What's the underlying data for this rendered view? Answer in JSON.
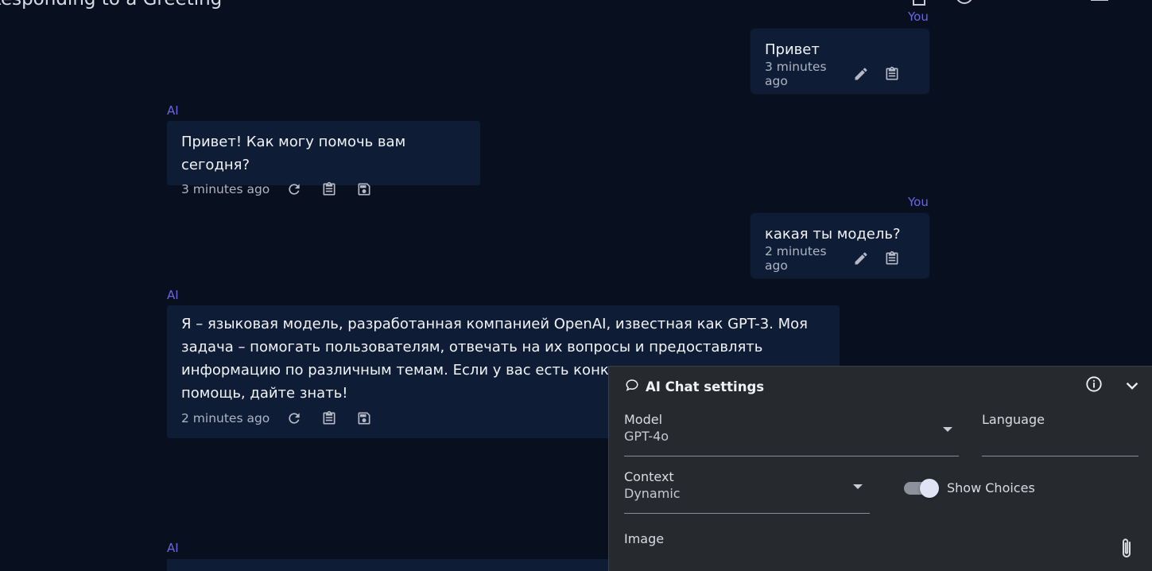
{
  "header": {
    "title": "Responding to a Greeting",
    "icons": [
      "clipboard-icon",
      "history-icon",
      "plus-icon",
      "list-icon",
      "grid-icon",
      "more-icon"
    ]
  },
  "messages": [
    {
      "sender": "You",
      "role": "user",
      "text": "Привет",
      "time": "3 minutes ago",
      "actions": [
        "edit-icon",
        "copy-icon"
      ]
    },
    {
      "sender": "AI",
      "role": "ai",
      "text": "Привет! Как могу помочь вам сегодня?",
      "time": "3 minutes ago",
      "actions": [
        "regenerate-icon",
        "copy-icon",
        "save-icon"
      ]
    },
    {
      "sender": "You",
      "role": "user",
      "text": "какая ты модель?",
      "time": "2 minutes ago",
      "actions": [
        "edit-icon",
        "copy-icon"
      ]
    },
    {
      "sender": "AI",
      "role": "ai",
      "text": "Я – языковая модель, разработанная компанией OpenAI, известная как GPT-3. Моя задача – помогать пользователям, отвечать на их вопросы и предоставлять информацию по различным темам. Если у вас есть конкр",
      "text_tail": "помощь, дайте знать!",
      "time": "2 minutes ago",
      "actions": [
        "regenerate-icon",
        "copy-icon",
        "save-icon"
      ]
    },
    {
      "sender": "AI",
      "role": "ai"
    }
  ],
  "settings": {
    "title": "AI Chat settings",
    "model": {
      "label": "Model",
      "value": "GPT-4o"
    },
    "language": {
      "label": "Language",
      "value": ""
    },
    "context": {
      "label": "Context",
      "value": "Dynamic"
    },
    "show_choices": {
      "label": "Show Choices",
      "enabled": true
    },
    "image": {
      "label": "Image"
    }
  },
  "colors": {
    "background": "#080f1e",
    "bubble": "#0f1c36",
    "sender_label": "#6a67e0",
    "panel": "#262a2f"
  }
}
